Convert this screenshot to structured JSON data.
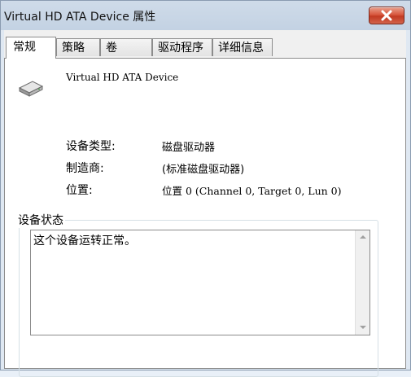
{
  "window": {
    "title": "Virtual HD ATA Device 属性"
  },
  "tabs": [
    {
      "label": "常规",
      "active": true
    },
    {
      "label": "策略",
      "active": false
    },
    {
      "label": "卷",
      "active": false
    },
    {
      "label": "驱动程序",
      "active": false
    },
    {
      "label": "详细信息",
      "active": false
    }
  ],
  "general": {
    "device_name": "Virtual HD ATA Device",
    "device_type_label": "设备类型:",
    "device_type_value": "磁盘驱动器",
    "manufacturer_label": "制造商:",
    "manufacturer_value": "(标准磁盘驱动器)",
    "location_label": "位置:",
    "location_value": "位置 0 (Channel 0, Target 0, Lun 0)"
  },
  "status": {
    "group_label": "设备状态",
    "text": "这个设备运转正常。"
  },
  "icons": {
    "device": "hard-disk-icon",
    "close": "close-icon",
    "scroll_up": "scroll-up-arrow-icon",
    "scroll_down": "scroll-down-arrow-icon"
  },
  "colors": {
    "close_button": "#d8583f",
    "title_bar": "#c3d2e3"
  }
}
